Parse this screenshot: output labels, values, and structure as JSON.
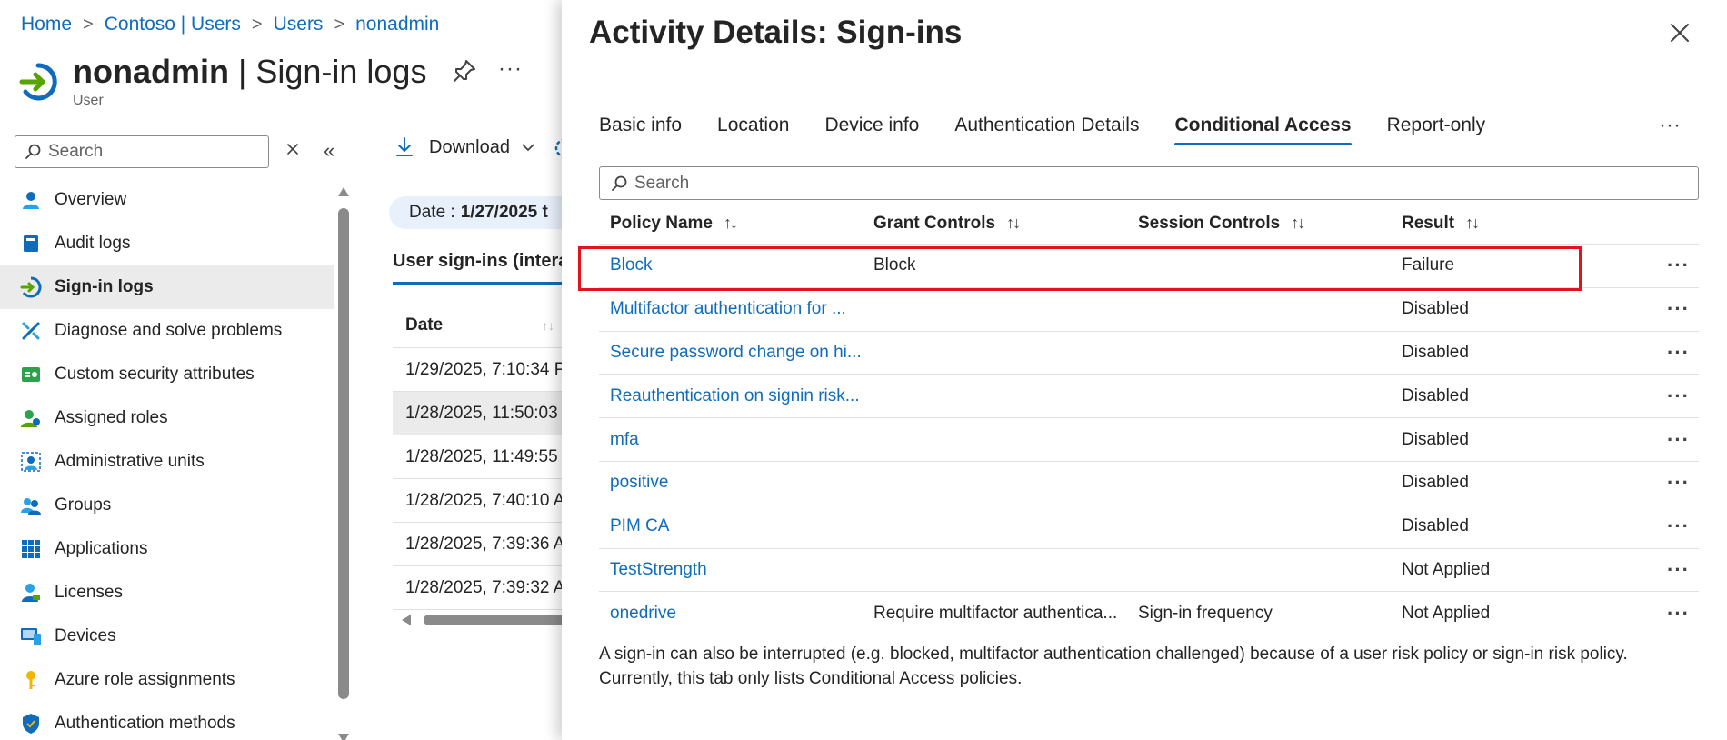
{
  "breadcrumb": [
    "Home",
    "Contoso | Users",
    "Users",
    "nonadmin"
  ],
  "header": {
    "title_bold": "nonadmin",
    "title_rest": " | Sign-in logs",
    "subtitle": "User",
    "more": "···"
  },
  "sidebar": {
    "search_placeholder": "Search",
    "collapse": "«",
    "items": [
      {
        "label": "Overview",
        "icon": "user-icon"
      },
      {
        "label": "Audit logs",
        "icon": "book-icon"
      },
      {
        "label": "Sign-in logs",
        "icon": "sign-in-icon",
        "active": true
      },
      {
        "label": "Diagnose and solve problems",
        "icon": "wrench-icon"
      },
      {
        "label": "Custom security attributes",
        "icon": "attributes-icon"
      },
      {
        "label": "Assigned roles",
        "icon": "role-icon"
      },
      {
        "label": "Administrative units",
        "icon": "admin-units-icon"
      },
      {
        "label": "Groups",
        "icon": "groups-icon"
      },
      {
        "label": "Applications",
        "icon": "apps-grid-icon"
      },
      {
        "label": "Licenses",
        "icon": "license-icon"
      },
      {
        "label": "Devices",
        "icon": "devices-icon"
      },
      {
        "label": "Azure role assignments",
        "icon": "key-icon"
      },
      {
        "label": "Authentication methods",
        "icon": "shield-icon"
      }
    ]
  },
  "background": {
    "download_label": "Download",
    "date_prefix": "Date :",
    "date_value": "1/27/2025 t",
    "tab_label": "User sign-ins (intera",
    "column_date": "Date",
    "rows": [
      "1/29/2025, 7:10:34 P",
      "1/28/2025, 11:50:03",
      "1/28/2025, 11:49:55",
      "1/28/2025, 7:40:10 A",
      "1/28/2025, 7:39:36 A",
      "1/28/2025, 7:39:32 A"
    ]
  },
  "panel": {
    "title": "Activity Details: Sign-ins",
    "tabs": [
      "Basic info",
      "Location",
      "Device info",
      "Authentication Details",
      "Conditional Access",
      "Report-only"
    ],
    "active_tab": "Conditional Access",
    "tabs_more": "···",
    "search_placeholder": "Search",
    "columns": [
      "Policy Name",
      "Grant Controls",
      "Session Controls",
      "Result"
    ],
    "sort_icon": "↑↓",
    "row_more": "···",
    "rows": [
      {
        "policy": "Block",
        "grant": "Block",
        "session": "",
        "result": "Failure"
      },
      {
        "policy": "Multifactor authentication for ...",
        "grant": "",
        "session": "",
        "result": "Disabled"
      },
      {
        "policy": "Secure password change on hi...",
        "grant": "",
        "session": "",
        "result": "Disabled"
      },
      {
        "policy": "Reauthentication on signin risk...",
        "grant": "",
        "session": "",
        "result": "Disabled"
      },
      {
        "policy": "mfa",
        "grant": "",
        "session": "",
        "result": "Disabled"
      },
      {
        "policy": "positive",
        "grant": "",
        "session": "",
        "result": "Disabled"
      },
      {
        "policy": "PIM CA",
        "grant": "",
        "session": "",
        "result": "Disabled"
      },
      {
        "policy": "TestStrength",
        "grant": "",
        "session": "",
        "result": "Not Applied"
      },
      {
        "policy": "onedrive",
        "grant": "Require multifactor authentica...",
        "session": "Sign-in frequency",
        "result": "Not Applied"
      }
    ],
    "footnote_1": "A sign-in can also be interrupted (e.g. blocked, multifactor authentication challenged) because of a user risk policy or sign-in risk policy.",
    "footnote_2": "Currently, this tab only lists Conditional Access policies."
  },
  "colors": {
    "link": "#0f6cbd",
    "highlight_border": "#e3121b",
    "active_nav_bg": "#ebebeb"
  }
}
